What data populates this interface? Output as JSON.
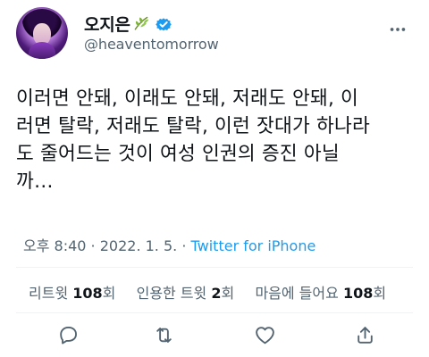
{
  "tweet": {
    "author": {
      "display_name": "오지은",
      "handle": "@heaventomorrow",
      "avatar_icon": "profile-photo",
      "name_emoji": "leaf-emoji",
      "verified_icon": "verified-badge-icon"
    },
    "text": "이러면 안돼, 이래도 안돼, 저래도 안돼, 이\n러면 탈락, 저래도 탈락, 이런 잣대가 하나라\n도 줄어드는 것이 여성 인권의 증진 아닐\n까…",
    "time": "오후 8:40",
    "date": "2022. 1. 5.",
    "source": "Twitter for iPhone",
    "separator": " · ",
    "stats": {
      "retweets_label": "리트윗",
      "retweets_count": "108",
      "retweets_unit": "회",
      "quotes_label": "인용한 트윗",
      "quotes_count": "2",
      "quotes_unit": "회",
      "likes_label": "마음에 들어요",
      "likes_count": "108",
      "likes_unit": "회"
    },
    "actions": [
      {
        "name": "reply-button",
        "icon": "reply-icon"
      },
      {
        "name": "retweet-button",
        "icon": "retweet-icon"
      },
      {
        "name": "like-button",
        "icon": "heart-icon"
      },
      {
        "name": "share-button",
        "icon": "share-icon"
      }
    ],
    "colors": {
      "accent": "#1d9bf0",
      "muted": "#536471",
      "text": "#0f1419",
      "divider": "#eff3f4"
    }
  }
}
